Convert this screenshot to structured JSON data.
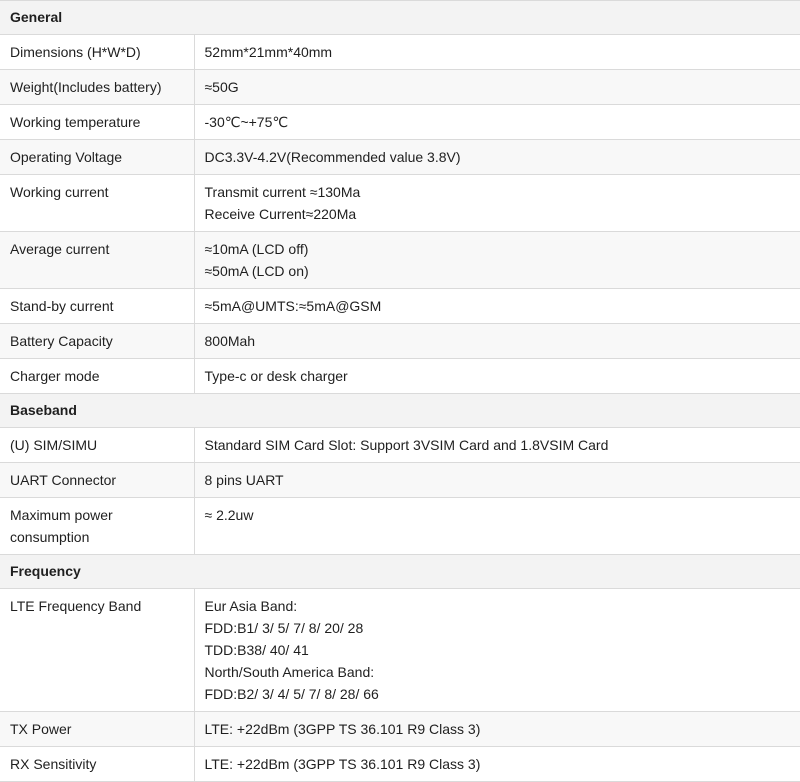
{
  "sections": {
    "general": "General",
    "baseband": "Baseband",
    "frequency": "Frequency"
  },
  "rows": {
    "dimensions": {
      "label": "Dimensions (H*W*D)",
      "value": "52mm*21mm*40mm"
    },
    "weight": {
      "label": "Weight(Includes battery)",
      "value": "≈50G"
    },
    "working_temperature": {
      "label": "Working temperature",
      "value": "-30℃~+75℃"
    },
    "operating_voltage": {
      "label": "Operating Voltage",
      "value": "DC3.3V-4.2V(Recommended value 3.8V)"
    },
    "working_current": {
      "label": "Working current",
      "lines": [
        "Transmit current ≈130Ma",
        "Receive Current≈220Ma"
      ]
    },
    "average_current": {
      "label": "Average current",
      "lines": [
        "≈10mA (LCD off)",
        "≈50mA (LCD on)"
      ]
    },
    "standby_current": {
      "label": "Stand-by current",
      "value": "≈5mA@UMTS:≈5mA@GSM"
    },
    "battery_capacity": {
      "label": "Battery Capacity",
      "value": "800Mah"
    },
    "charger_mode": {
      "label": "Charger mode",
      "value": "Type-c or desk charger"
    },
    "sim": {
      "label": "(U) SIM/SIMU",
      "value": "Standard SIM Card Slot: Support 3VSIM Card and 1.8VSIM Card"
    },
    "uart": {
      "label": "UART Connector",
      "value": "8 pins UART"
    },
    "max_power": {
      "label": "Maximum power consumption",
      "value": "≈ 2.2uw"
    },
    "lte_band": {
      "label": "LTE Frequency Band",
      "lines": [
        "Eur Asia Band:",
        "FDD:B1/ 3/ 5/ 7/ 8/ 20/ 28",
        "TDD:B38/ 40/ 41",
        "North/South America Band:",
        "FDD:B2/ 3/ 4/ 5/ 7/ 8/ 28/ 66"
      ]
    },
    "tx_power": {
      "label": "TX Power",
      "value": "LTE: +22dBm (3GPP TS 36.101 R9 Class 3)"
    },
    "rx_sensitivity": {
      "label": "RX Sensitivity",
      "value": "LTE: +22dBm (3GPP TS 36.101 R9 Class 3)"
    }
  }
}
